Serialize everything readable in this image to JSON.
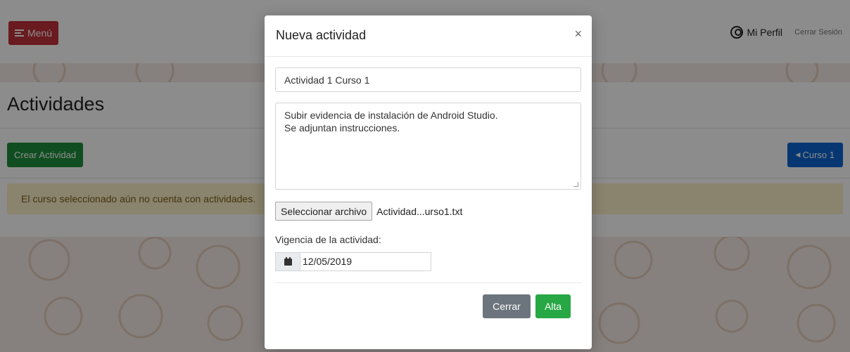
{
  "navbar": {
    "menu_label": "Menú",
    "profile_label": "Mi Perfil",
    "logout_label": "Cerrar Sesión"
  },
  "page": {
    "title": "Actividades",
    "create_button": "Crear Actividad",
    "course_button": "Curso 1",
    "empty_alert": "El curso seleccionado aún no cuenta con actividades."
  },
  "modal": {
    "title": "Nueva actividad",
    "close_icon": "×",
    "activity_name": "Actividad 1 Curso 1",
    "description_line1": "Subir evidencia de instalación de Android Studio.",
    "description_line2": "Se adjuntan instrucciones.",
    "file_button": "Seleccionar archivo",
    "file_name": "Actividad...urso1.txt",
    "validity_label": "Vigencia de la actividad:",
    "validity_date": "12/05/2019",
    "close_button": "Cerrar",
    "submit_button": "Alta"
  },
  "colors": {
    "menu": "#c0323a",
    "create": "#1e8f3d",
    "course": "#0d64d0",
    "alert_bg": "#fcefc6",
    "close_btn": "#6c757d",
    "alta_btn": "#28a745"
  }
}
